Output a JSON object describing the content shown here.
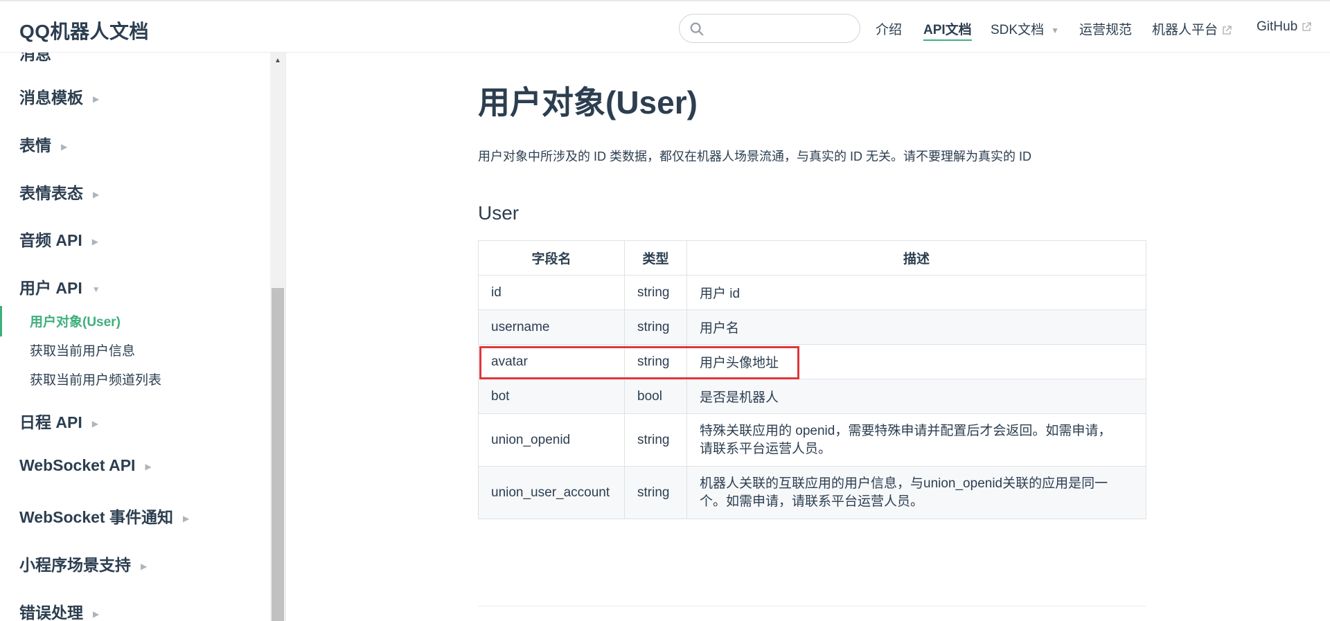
{
  "navbar": {
    "site_title": "QQ机器人文档",
    "search": {
      "placeholder": ""
    },
    "links": [
      {
        "label": "介绍",
        "active": false
      },
      {
        "label": "API文档",
        "active": true
      },
      {
        "label": "SDK文档",
        "active": false,
        "dropdown": true
      },
      {
        "label": "运营规范",
        "active": false
      },
      {
        "label": "机器人平台",
        "active": false,
        "external": true
      },
      {
        "label": "GitHub",
        "active": false,
        "external": true
      }
    ]
  },
  "sidebar": {
    "partial_top": "消息",
    "groups": [
      {
        "label": "消息模板",
        "expanded": false
      },
      {
        "label": "表情",
        "expanded": false
      },
      {
        "label": "表情表态",
        "expanded": false
      },
      {
        "label": "音频 API",
        "expanded": false
      },
      {
        "label": "用户 API",
        "expanded": true
      },
      {
        "label": "日程 API",
        "expanded": false
      },
      {
        "label": "WebSocket API",
        "expanded": false
      },
      {
        "label": "WebSocket 事件通知",
        "expanded": false
      },
      {
        "label": "小程序场景支持",
        "expanded": false
      },
      {
        "label": "错误处理",
        "expanded": false
      }
    ],
    "user_api_links": [
      {
        "label": "用户对象(User)",
        "active": true
      },
      {
        "label": "获取当前用户信息",
        "active": false
      },
      {
        "label": "获取当前用户频道列表",
        "active": false
      }
    ]
  },
  "content": {
    "title": "用户对象(User)",
    "intro": "用户对象中所涉及的 ID 类数据，都仅在机器人场景流通，与真实的 ID 无关。请不要理解为真实的 ID",
    "section_title": "User",
    "table": {
      "headers": [
        "字段名",
        "类型",
        "描述"
      ],
      "rows": [
        {
          "field": "id",
          "type": "string",
          "desc": "用户 id"
        },
        {
          "field": "username",
          "type": "string",
          "desc": "用户名"
        },
        {
          "field": "avatar",
          "type": "string",
          "desc": "用户头像地址",
          "highlighted": true
        },
        {
          "field": "bot",
          "type": "bool",
          "desc": "是否是机器人"
        },
        {
          "field": "union_openid",
          "type": "string",
          "desc_line1": "特殊关联应用的 openid，需要特殊申请并配置后才会返回。如需申请，",
          "desc_line2": "请联系平台运营人员。"
        },
        {
          "field": "union_user_account",
          "type": "string",
          "desc_line1": "机器人关联的互联应用的用户信息，与union_openid关联的应用是同一",
          "desc_line2": "个。如需申请，请联系平台运营人员。"
        }
      ]
    }
  },
  "colors": {
    "accent": "#3eaf7c",
    "highlight_box": "#e0353b",
    "text": "#2c3e50"
  }
}
